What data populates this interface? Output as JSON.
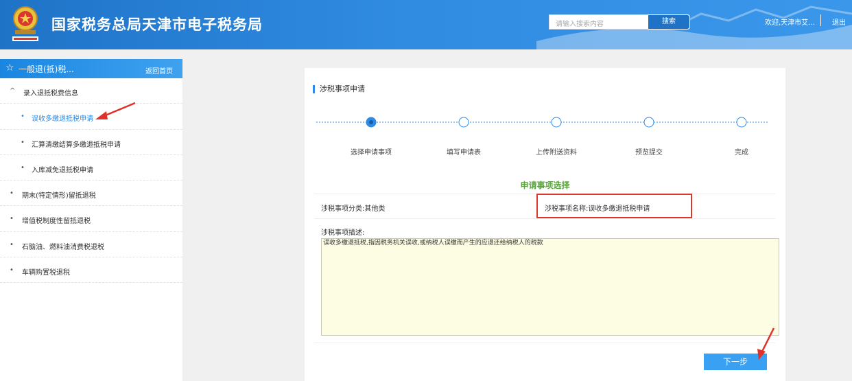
{
  "header": {
    "title": "国家税务总局天津市电子税务局",
    "search_placeholder": "请输入搜索内容",
    "search_label": "搜索",
    "welcome": "欢迎,天津市艾...",
    "logout": "退出"
  },
  "sidebar": {
    "title": "一般退(抵)税...",
    "home_link": "返回首页",
    "items": [
      {
        "label": "录入退抵税费信息",
        "marker": "^",
        "level": 0
      },
      {
        "label": "误收多缴退抵税申请",
        "marker": "•",
        "level": 1,
        "active": true
      },
      {
        "label": "汇算清缴结算多缴退抵税申请",
        "marker": "•",
        "level": 1
      },
      {
        "label": "入库减免退抵税申请",
        "marker": "•",
        "level": 1
      },
      {
        "label": "期末(特定情形)留抵退税",
        "marker": "•",
        "level": 0
      },
      {
        "label": "增值税制度性留抵退税",
        "marker": "•",
        "level": 0
      },
      {
        "label": "石脑油、燃料油消费税退税",
        "marker": "•",
        "level": 0
      },
      {
        "label": "车辆购置税退税",
        "marker": "•",
        "level": 0
      }
    ]
  },
  "main": {
    "section_title": "涉税事项申请",
    "steps": [
      {
        "label": "选择申请事项",
        "current": true
      },
      {
        "label": "填写申请表"
      },
      {
        "label": "上传附送资料"
      },
      {
        "label": "预览提交"
      },
      {
        "label": "完成"
      }
    ],
    "choice_title": "申请事项选择",
    "category": "涉税事项分类:其他类",
    "item_name": "涉税事项名称:误收多缴退抵税申请",
    "desc_label": "涉税事项描述:",
    "description": "误收多缴退抵税,指因税务机关误收,或纳税人误缴而产生的应退还给纳税人的税款",
    "next_label": "下一步"
  },
  "colors": {
    "header_blue": "#1f73c7",
    "accent_blue": "#2d8ae6",
    "green_title": "#5aa33d",
    "highlight_red": "#d9382f"
  }
}
